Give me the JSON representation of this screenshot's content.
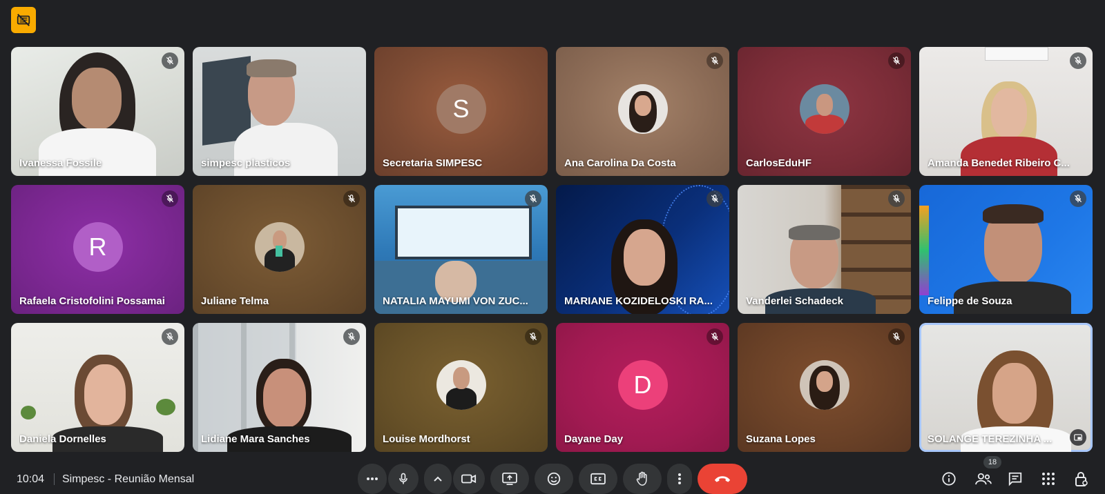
{
  "meeting": {
    "time": "10:04",
    "title": "Simpesc - Reunião Mensal",
    "participant_count": "18"
  },
  "participants": [
    {
      "name": "Ivanessa Fossile"
    },
    {
      "name": "simpesc plasticos"
    },
    {
      "name": "Secretaria SIMPESC",
      "initial": "S"
    },
    {
      "name": "Ana Carolina Da Costa"
    },
    {
      "name": "CarlosEduHF"
    },
    {
      "name": "Amanda Benedet Ribeiro C..."
    },
    {
      "name": "Rafaela Cristofolini Possamai",
      "initial": "R"
    },
    {
      "name": "Juliane Telma"
    },
    {
      "name": "NATALIA MAYUMI VON ZUC..."
    },
    {
      "name": "MARIANE KOZIDELOSKI RA..."
    },
    {
      "name": "Vanderlei Schadeck"
    },
    {
      "name": "Felippe de Souza"
    },
    {
      "name": "Daniela Dornelles"
    },
    {
      "name": "Lidiane Mara Sanches"
    },
    {
      "name": "Louise Mordhorst"
    },
    {
      "name": "Dayane Day",
      "initial": "D"
    },
    {
      "name": "Suzana Lopes"
    },
    {
      "name": "SOLANGE TEREZINHA ..."
    }
  ],
  "colors": {
    "end_call": "#ea4335",
    "recording_badge": "#f9ab00",
    "active_speaker": "#a8c7fa"
  }
}
